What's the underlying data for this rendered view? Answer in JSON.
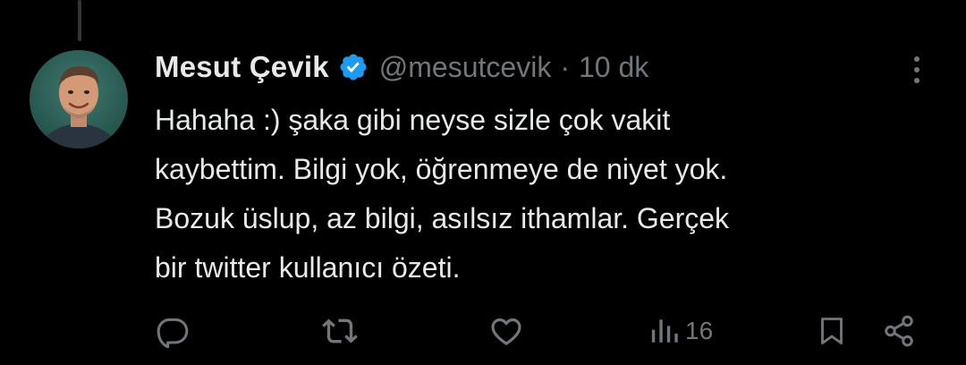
{
  "tweet": {
    "display_name": "Mesut Çevik",
    "verified_icon": "verified-badge-icon",
    "handle": "@mesutcevik",
    "separator": "·",
    "time": "10 dk",
    "text_lines": [
      "Hahaha :) şaka gibi neyse sizle çok vakit",
      "kaybettim. Bilgi yok, öğrenmeye de niyet yok.",
      "Bozuk üslup, az bilgi, asılsız ithamlar. Gerçek",
      "bir twitter kullanıcı özeti."
    ]
  },
  "actions": {
    "reply_icon": "reply-icon",
    "retweet_icon": "retweet-icon",
    "like_icon": "like-icon",
    "views_icon": "views-icon",
    "views_count": "16",
    "bookmark_icon": "bookmark-icon",
    "share_icon": "share-icon"
  },
  "colors": {
    "background": "#000000",
    "text_primary": "#e7e9ea",
    "text_secondary": "#71767b",
    "verified_blue": "#1d9bf0"
  }
}
